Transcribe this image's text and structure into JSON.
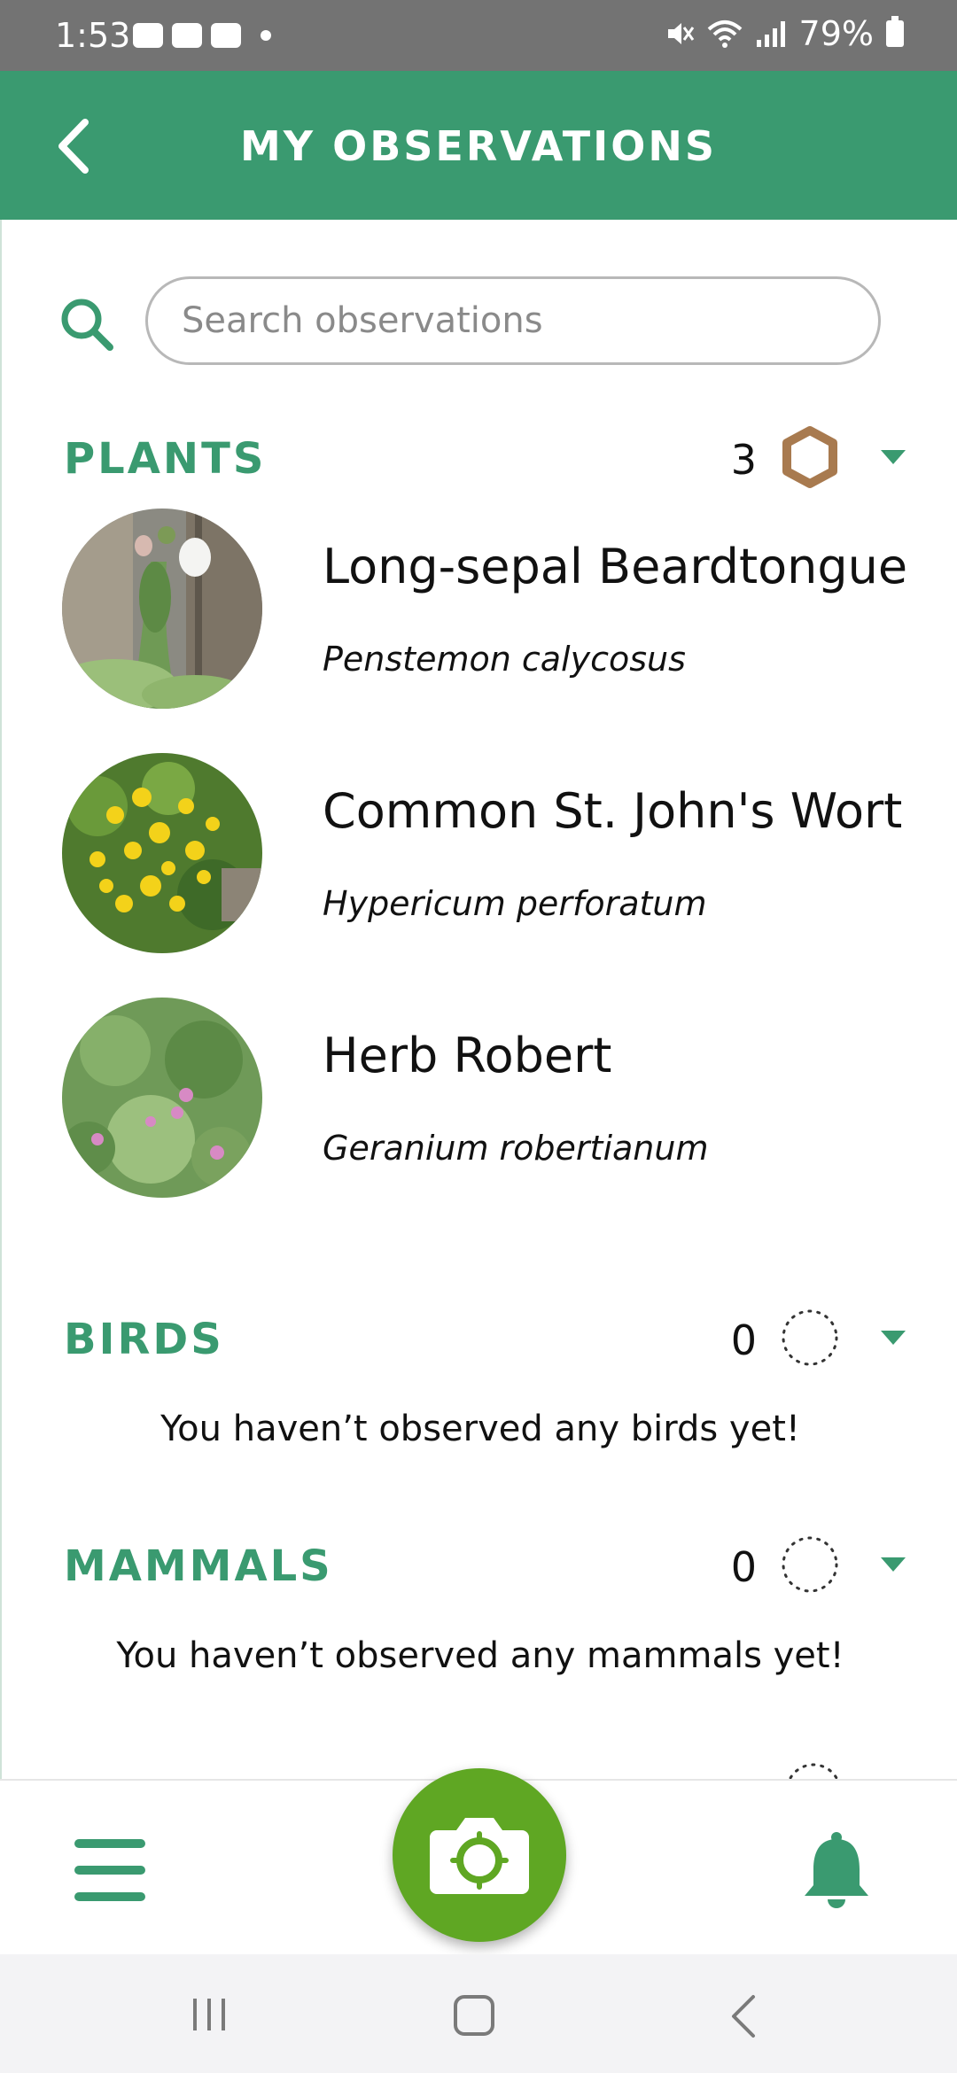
{
  "status_bar": {
    "time": "1:53",
    "battery": "79%"
  },
  "app_bar": {
    "title": "MY OBSERVATIONS"
  },
  "search": {
    "placeholder": "Search observations"
  },
  "sections": {
    "plants": {
      "label": "PLANTS",
      "count": "3",
      "items": [
        {
          "common": "Long-sepal Beardtongue",
          "scientific": "Penstemon calycosus"
        },
        {
          "common": "Common St. John's Wort",
          "scientific": "Hypericum perforatum"
        },
        {
          "common": "Herb Robert",
          "scientific": "Geranium robertianum"
        }
      ]
    },
    "birds": {
      "label": "BIRDS",
      "count": "0",
      "empty": "You haven’t observed any birds yet!"
    },
    "mammals": {
      "label": "MAMMALS",
      "count": "0",
      "empty": "You haven’t observed any mammals yet!"
    }
  },
  "colors": {
    "primary": "#3a9a70",
    "camera": "#5fa723",
    "badge_plants": "#a87a4f"
  },
  "icons": {
    "back": "chevron-left-icon",
    "search": "search-icon",
    "badge_filled": "hexagon-icon",
    "badge_empty": "dotted-circle-icon",
    "menu": "hamburger-icon",
    "camera": "camera-icon",
    "notifications": "bell-icon"
  }
}
